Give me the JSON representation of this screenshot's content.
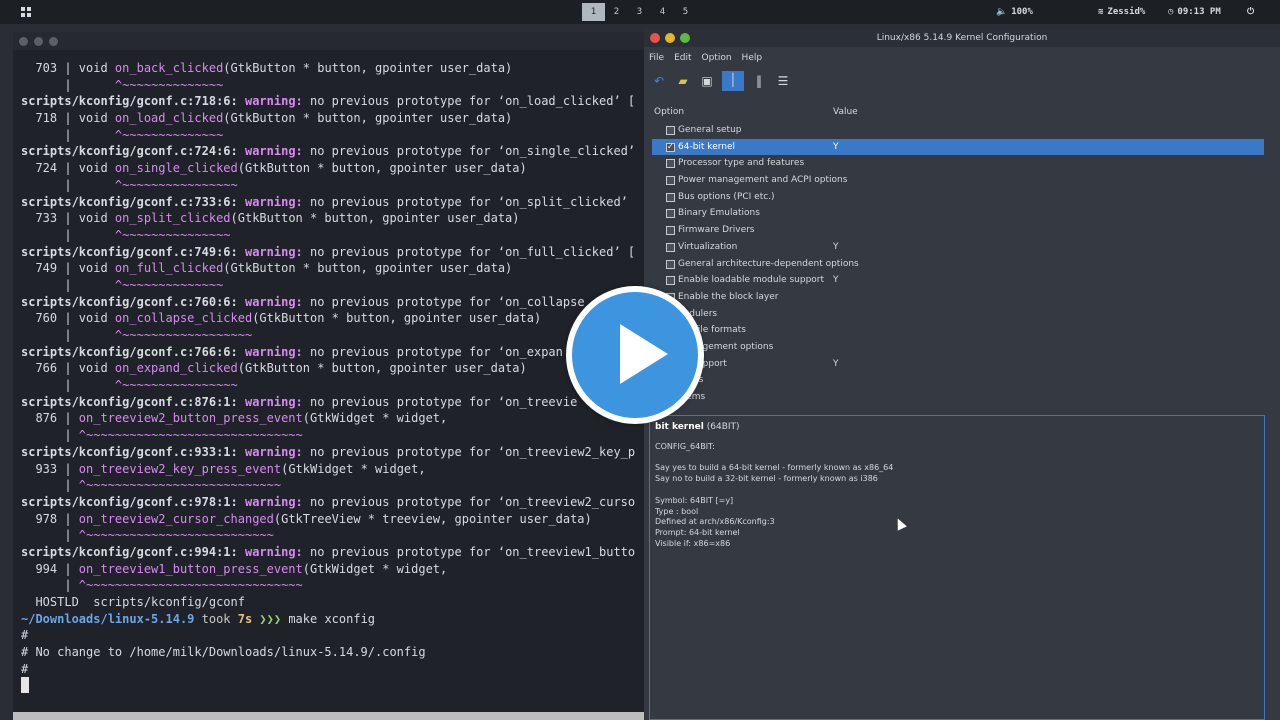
{
  "topbar": {
    "workspaces": [
      "1",
      "2",
      "3",
      "4",
      "5"
    ],
    "active_workspace": "1",
    "volume": "100%",
    "wifi": "Zessid%",
    "clock": "09:13 PM"
  },
  "terminal": {
    "lines": [
      {
        "type": "code",
        "num": "703",
        "fn": "on_back_clicked",
        "rest": "(GtkButton * button, gpointer user_data)"
      },
      {
        "type": "tilde",
        "text": "^~~~~~~~~~~~~~~",
        "indent": "      |      "
      },
      {
        "type": "warn",
        "loc": "scripts/kconfig/gconf.c:718:6:",
        "msg": " no previous prototype for ‘on_load_clicked’ ["
      },
      {
        "type": "code",
        "num": "718",
        "fn": "on_load_clicked",
        "rest": "(GtkButton * button, gpointer user_data)"
      },
      {
        "type": "tilde",
        "text": "^~~~~~~~~~~~~~~",
        "indent": "      |      "
      },
      {
        "type": "warn",
        "loc": "scripts/kconfig/gconf.c:724:6:",
        "msg": " no previous prototype for ‘on_single_clicked’"
      },
      {
        "type": "code",
        "num": "724",
        "fn": "on_single_clicked",
        "rest": "(GtkButton * button, gpointer user_data)"
      },
      {
        "type": "tilde",
        "text": "^~~~~~~~~~~~~~~~~",
        "indent": "      |      "
      },
      {
        "type": "warn",
        "loc": "scripts/kconfig/gconf.c:733:6:",
        "msg": " no previous prototype for ‘on_split_clicked’"
      },
      {
        "type": "code",
        "num": "733",
        "fn": "on_split_clicked",
        "rest": "(GtkButton * button, gpointer user_data)"
      },
      {
        "type": "tilde",
        "text": "^~~~~~~~~~~~~~~~",
        "indent": "      |      "
      },
      {
        "type": "warn",
        "loc": "scripts/kconfig/gconf.c:749:6:",
        "msg": " no previous prototype for ‘on_full_clicked’ ["
      },
      {
        "type": "code",
        "num": "749",
        "fn": "on_full_clicked",
        "rest": "(GtkButton * button, gpointer user_data)"
      },
      {
        "type": "tilde",
        "text": "^~~~~~~~~~~~~~~",
        "indent": "      |      "
      },
      {
        "type": "warn",
        "loc": "scripts/kconfig/gconf.c:760:6:",
        "msg": " no previous prototype for ‘on_collapse"
      },
      {
        "type": "code",
        "num": "760",
        "fn": "on_collapse_clicked",
        "rest": "(GtkButton * button, gpointer user_data)"
      },
      {
        "type": "tilde",
        "text": "^~~~~~~~~~~~~~~~~~~",
        "indent": "      |      "
      },
      {
        "type": "warn",
        "loc": "scripts/kconfig/gconf.c:766:6:",
        "msg": " no previous prototype for ‘on_expan"
      },
      {
        "type": "code",
        "num": "766",
        "fn": "on_expand_clicked",
        "rest": "(GtkButton * button, gpointer user_data)"
      },
      {
        "type": "tilde",
        "text": "^~~~~~~~~~~~~~~~~",
        "indent": "      |      "
      },
      {
        "type": "warn",
        "loc": "scripts/kconfig/gconf.c:876:1:",
        "msg": " no previous prototype for ‘on_treevie"
      },
      {
        "type": "code2",
        "num": "876",
        "fn": "on_treeview2_button_press_event",
        "rest": "(GtkWidget * widget,"
      },
      {
        "type": "tilde",
        "text": "^~~~~~~~~~~~~~~~~~~~~~~~~~~~~~~",
        "indent": "      | "
      },
      {
        "type": "warn",
        "loc": "scripts/kconfig/gconf.c:933:1:",
        "msg": " no previous prototype for ‘on_treeview2_key_p"
      },
      {
        "type": "code2",
        "num": "933",
        "fn": "on_treeview2_key_press_event",
        "rest": "(GtkWidget * widget,"
      },
      {
        "type": "tilde",
        "text": "^~~~~~~~~~~~~~~~~~~~~~~~~~~~",
        "indent": "      | "
      },
      {
        "type": "warn",
        "loc": "scripts/kconfig/gconf.c:978:1:",
        "msg": " no previous prototype for ‘on_treeview2_curso"
      },
      {
        "type": "code2",
        "num": "978",
        "fn": "on_treeview2_cursor_changed",
        "rest": "(GtkTreeView * treeview, gpointer user_data)"
      },
      {
        "type": "tilde",
        "text": "^~~~~~~~~~~~~~~~~~~~~~~~~~~",
        "indent": "      | "
      },
      {
        "type": "warn",
        "loc": "scripts/kconfig/gconf.c:994:1:",
        "msg": " no previous prototype for ‘on_treeview1_butto"
      },
      {
        "type": "code2",
        "num": "994",
        "fn": "on_treeview1_button_press_event",
        "rest": "(GtkWidget * widget,"
      },
      {
        "type": "tilde",
        "text": "^~~~~~~~~~~~~~~~~~~~~~~~~~~~~~~",
        "indent": "      | "
      }
    ],
    "hostld": "  HOSTLD  scripts/kconfig/gconf",
    "prompt_path": "~/Downloads/linux-5.14.9",
    "prompt_took": " took ",
    "prompt_time": "7s",
    "prompt_arrows": " ❯❯❯ ",
    "prompt_cmd": "make xconfig",
    "out1": "#",
    "out2": "# No change to /home/milk/Downloads/linux-5.14.9/.config",
    "out3": "#",
    "warning_label": "warning:"
  },
  "xconfig": {
    "title": "Linux/x86 5.14.9 Kernel Configuration",
    "menus": [
      "File",
      "Edit",
      "Option",
      "Help"
    ],
    "col_option": "Option",
    "col_value": "Value",
    "options": [
      {
        "label": "General setup",
        "value": "",
        "checked": false,
        "selected": false
      },
      {
        "label": "64-bit kernel",
        "value": "Y",
        "checked": true,
        "selected": true
      },
      {
        "label": "Processor type and features",
        "value": "",
        "checked": false,
        "selected": false
      },
      {
        "label": "Power management and ACPI options",
        "value": "",
        "checked": false,
        "selected": false
      },
      {
        "label": "Bus options (PCI etc.)",
        "value": "",
        "checked": false,
        "selected": false
      },
      {
        "label": "Binary Emulations",
        "value": "",
        "checked": false,
        "selected": false
      },
      {
        "label": "Firmware Drivers",
        "value": "",
        "checked": false,
        "selected": false
      },
      {
        "label": "Virtualization",
        "value": "Y",
        "checked": false,
        "selected": false
      },
      {
        "label": "General architecture-dependent options",
        "value": "",
        "checked": false,
        "selected": false
      },
      {
        "label": "Enable loadable module support",
        "value": "Y",
        "checked": false,
        "selected": false
      },
      {
        "label": "Enable the block layer",
        "value": "",
        "checked": false,
        "selected": false
      },
      {
        "label": "hedulers",
        "value": "",
        "checked": false,
        "selected": false
      },
      {
        "label": "ble file formats",
        "value": "",
        "checked": false,
        "selected": false
      },
      {
        "label": "Management options",
        "value": "",
        "checked": false,
        "selected": false
      },
      {
        "label": "ng support",
        "value": "Y",
        "checked": false,
        "selected": false
      },
      {
        "label": "rivers",
        "value": "",
        "checked": false,
        "selected": false
      },
      {
        "label": "stems",
        "value": "",
        "checked": false,
        "selected": false
      }
    ],
    "help": {
      "title": "bit kernel",
      "title_sym": "(64BIT)",
      "config": "CONFIG_64BIT:",
      "desc1": "Say yes to build a 64-bit kernel - formerly known as x86_64",
      "desc2": "Say no to build a 32-bit kernel - formerly known as i386",
      "symbol": "Symbol: 64BIT [=y]",
      "type": "Type : bool",
      "defined": "Defined at arch/x86/Kconfig:3",
      "prompt": "Prompt: 64-bit kernel",
      "visible": "Visible if: x86=x86"
    }
  }
}
